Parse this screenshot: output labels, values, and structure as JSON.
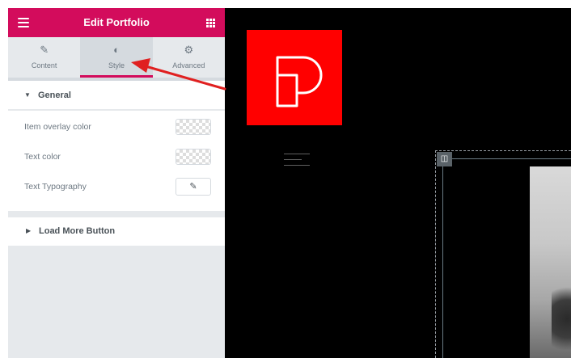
{
  "header": {
    "title": "Edit Portfolio",
    "menu_icon": "hamburger-icon",
    "apps_icon": "grid-icon"
  },
  "tabs": [
    {
      "label": "Content",
      "icon": "pencil-icon",
      "glyph": "✎"
    },
    {
      "label": "Style",
      "icon": "contrast-icon",
      "glyph": "◐"
    },
    {
      "label": "Advanced",
      "icon": "gear-icon",
      "glyph": "⚙"
    }
  ],
  "general": {
    "title": "General",
    "controls": [
      {
        "label": "Item overlay color"
      },
      {
        "label": "Text color"
      },
      {
        "label": "Text Typography"
      }
    ]
  },
  "load_more": {
    "title": "Load More Button"
  },
  "colors": {
    "accent": "#d30c5c",
    "panel_bg": "#e6e9ec",
    "logo": "#ff0000",
    "arrow": "#e02020"
  }
}
